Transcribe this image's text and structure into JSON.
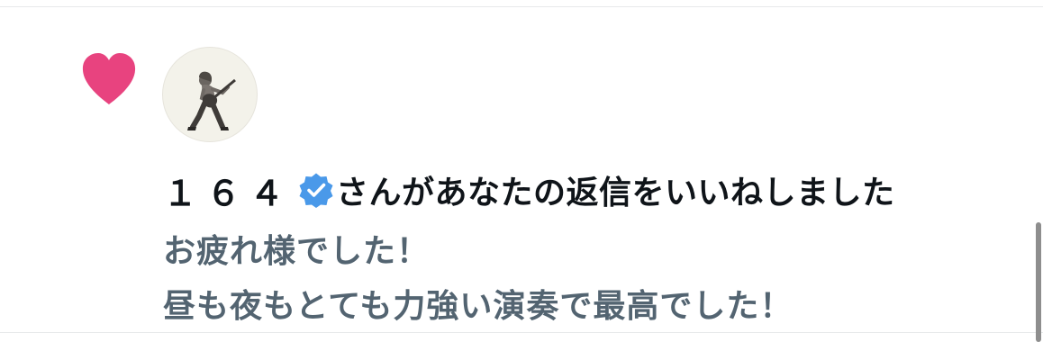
{
  "notification": {
    "type_icon": "heart-icon",
    "user_name": "１６４",
    "verified_icon": "verified-badge-icon",
    "action_text": "さんがあなたの返信をいいねしました",
    "reply_lines": [
      "お疲れ様でした！",
      "昼も夜もとても力強い演奏で最高でした！"
    ]
  },
  "colors": {
    "heart": "#e8437f",
    "verified": "#4a99e9",
    "name_text": "#0f1419",
    "reply_text": "#536471",
    "divider": "#e7e9ea"
  }
}
